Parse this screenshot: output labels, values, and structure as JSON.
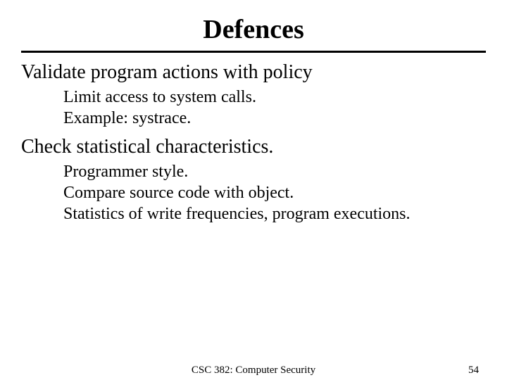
{
  "title": "Defences",
  "sections": [
    {
      "heading": "Validate program actions with policy",
      "items": [
        "Limit access to system calls.",
        "Example: systrace."
      ]
    },
    {
      "heading": "Check statistical characteristics.",
      "items": [
        "Programmer style.",
        "Compare source code with object.",
        "Statistics of write frequencies, program executions."
      ]
    }
  ],
  "footer": {
    "course": "CSC 382: Computer Security",
    "page": "54"
  }
}
